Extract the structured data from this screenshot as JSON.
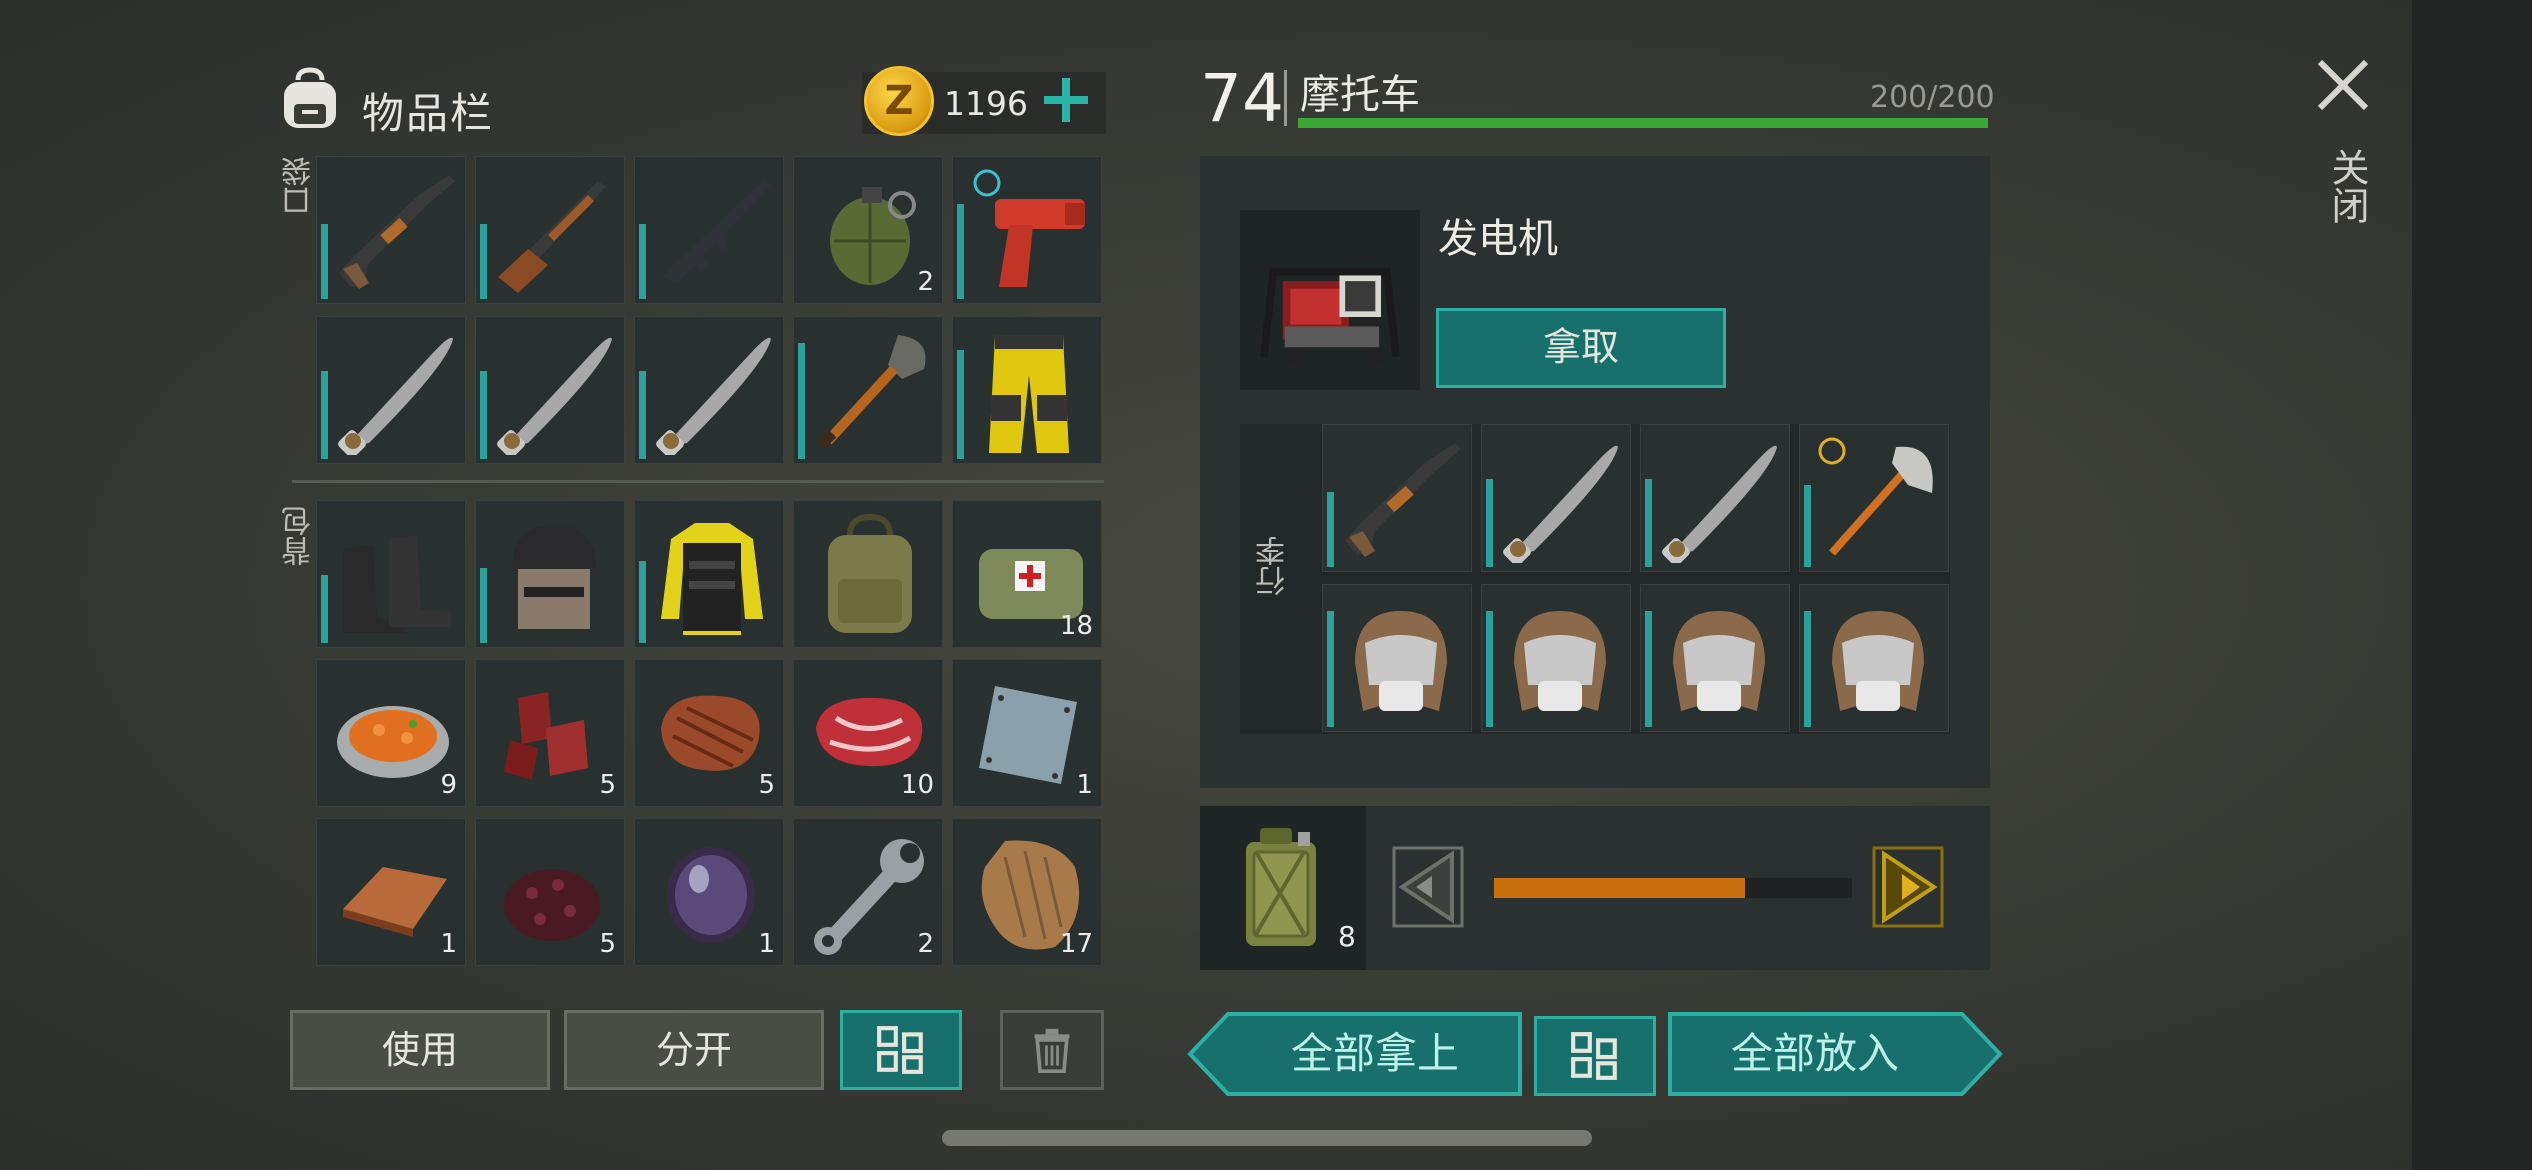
{
  "inventory": {
    "title": "物品栏",
    "coins": "1196",
    "coin_symbol": "Z",
    "pocket_label": "口袋",
    "backpack_label": "背包",
    "pockets": [
      {
        "name": "shotgun",
        "qty": "",
        "durability": 0.55
      },
      {
        "name": "rifle",
        "qty": "",
        "durability": 0.55
      },
      {
        "name": "assault-rifle",
        "qty": "",
        "durability": 0.55
      },
      {
        "name": "grenade",
        "qty": "2",
        "durability": 0
      },
      {
        "name": "flare-gun",
        "qty": "",
        "durability": 0.7
      },
      {
        "name": "machete",
        "qty": "",
        "durability": 0.65
      },
      {
        "name": "machete",
        "qty": "",
        "durability": 0.65
      },
      {
        "name": "machete",
        "qty": "",
        "durability": 0.65
      },
      {
        "name": "shovel",
        "qty": "",
        "durability": 0.85
      },
      {
        "name": "yellow-pants",
        "qty": "",
        "durability": 0.8
      }
    ],
    "backpack": [
      {
        "name": "boots",
        "qty": "",
        "durability": 0.5
      },
      {
        "name": "helmet",
        "qty": "",
        "durability": 0.55
      },
      {
        "name": "armored-jacket",
        "qty": "",
        "durability": 0.6
      },
      {
        "name": "backpack",
        "qty": "",
        "durability": 0
      },
      {
        "name": "medkit-bag",
        "qty": "18",
        "durability": 0
      },
      {
        "name": "carrot-dish",
        "qty": "9",
        "durability": 0
      },
      {
        "name": "raw-meat-strips",
        "qty": "5",
        "durability": 0
      },
      {
        "name": "steak",
        "qty": "5",
        "durability": 0
      },
      {
        "name": "raw-steak",
        "qty": "10",
        "durability": 0
      },
      {
        "name": "metal-plate",
        "qty": "1",
        "durability": 0
      },
      {
        "name": "copper-ingot",
        "qty": "1",
        "durability": 0
      },
      {
        "name": "berries",
        "qty": "5",
        "durability": 0
      },
      {
        "name": "lens",
        "qty": "1",
        "durability": 0
      },
      {
        "name": "wrench",
        "qty": "2",
        "durability": 0
      },
      {
        "name": "fur",
        "qty": "17",
        "durability": 0
      }
    ],
    "buttons": {
      "use": "使用",
      "split": "分开"
    }
  },
  "vehicle": {
    "level": "74",
    "name": "摩托车",
    "capacity": "200/200",
    "capacity_fraction": 1.0,
    "equipment_name": "发电机",
    "take_label": "拿取",
    "luggage_label": "行李",
    "luggage": [
      {
        "name": "shotgun",
        "durability": 0.55
      },
      {
        "name": "machete",
        "durability": 0.65
      },
      {
        "name": "machete",
        "durability": 0.65
      },
      {
        "name": "fire-axe",
        "durability": 0.6
      },
      {
        "name": "ushanka-hat",
        "durability": 0.85
      },
      {
        "name": "ushanka-hat",
        "durability": 0.85
      },
      {
        "name": "ushanka-hat",
        "durability": 0.85
      },
      {
        "name": "ushanka-hat",
        "durability": 0.85
      }
    ],
    "fuel_qty": "8",
    "fuel_fraction": 0.7,
    "buttons": {
      "take_all": "全部拿上",
      "put_all": "全部放入"
    }
  },
  "close_label": "关闭",
  "colors": {
    "teal": "#2cb0a4",
    "accent_green": "#3aa634",
    "fuel_orange": "#c87010",
    "gold": "#e0b020"
  }
}
